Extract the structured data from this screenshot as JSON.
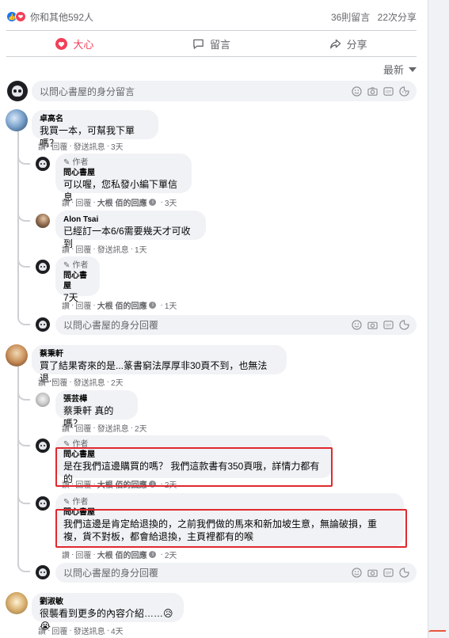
{
  "stats": {
    "reactions_text": "你和其他592人",
    "comments_count": "36則留言",
    "shares_count": "22次分享"
  },
  "actions": {
    "love": "大心",
    "comment": "留言",
    "share": "分享"
  },
  "sort": {
    "label": "最新"
  },
  "composer": {
    "placeholder": "以問心書屋的身分留言"
  },
  "reply_composer": {
    "placeholder": "以問心書屋的身分回覆"
  },
  "labels": {
    "author": "作者",
    "like": "讚",
    "reply": "回覆",
    "send": "發送訊息",
    "dot": "·"
  },
  "colors": {
    "accent_love": "#f33e58",
    "brand_blue": "#1877f2",
    "highlight": "#e0282e"
  },
  "threads": [
    {
      "comment": {
        "name": "卓高名",
        "text": "我買一本，可幫我下單嗎？",
        "time": "3天"
      },
      "replies": [
        {
          "name": "問心書屋",
          "author": true,
          "text": "可以喔，您私發小編下單信息",
          "reply_by": "大根 佰的回應",
          "time": "3天"
        },
        {
          "name": "Alon Tsai",
          "author": false,
          "text": "已經訂一本6/6需要幾天才可收到",
          "time": "1天"
        },
        {
          "name": "問心書屋",
          "author": true,
          "text": "7天",
          "reply_by": "大根 佰的回應",
          "time": "1天"
        }
      ]
    },
    {
      "comment": {
        "name": "蔡秉軒",
        "text": "買了結果寄來的是...篆書窮法厚厚非30頁不到，也無法退...",
        "time": "2天"
      },
      "replies": [
        {
          "name": "張芸樺",
          "author": false,
          "text": "蔡秉軒 真的嗎？",
          "time": "2天"
        },
        {
          "name": "問心書屋",
          "author": true,
          "text": "是在我們這邊購買的嗎？ 我們這款書有350頁哦，詳情力都有的",
          "reply_by": "大根 佰的回應",
          "time": "2天"
        },
        {
          "name": "問心書屋",
          "author": true,
          "text_line1": "我們這邊是肯定給退換的，之前我們做的馬來和新加坡生意，無論破損，重",
          "text_line2": "複，貨不對板，都會給退換，主頁裡都有的喉",
          "reply_by": "大根 佰的回應",
          "time": "2天"
        }
      ]
    },
    {
      "comment": {
        "name": "劉淑敏",
        "text": "很襲看到更多的內容介紹……",
        "emoji": "😥😭",
        "time": "4天"
      }
    }
  ]
}
